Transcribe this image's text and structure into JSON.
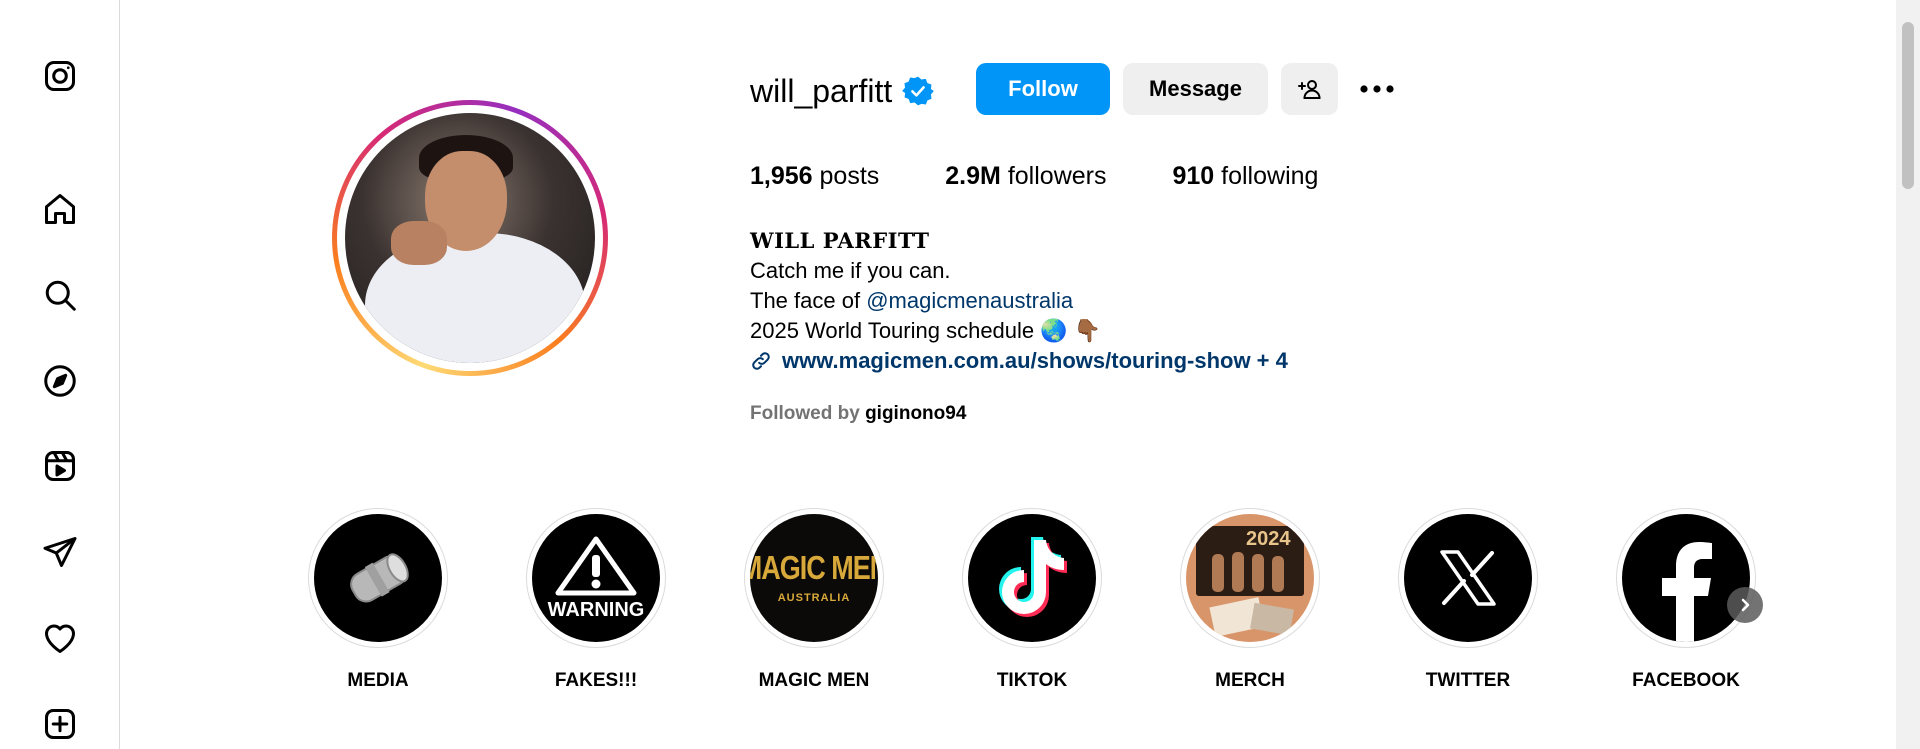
{
  "sidebar": {
    "items": [
      {
        "name": "instagram-logo-icon"
      },
      {
        "name": "home-icon"
      },
      {
        "name": "search-icon"
      },
      {
        "name": "explore-icon"
      },
      {
        "name": "reels-icon"
      },
      {
        "name": "messages-icon"
      },
      {
        "name": "notifications-icon"
      },
      {
        "name": "create-icon"
      }
    ]
  },
  "profile": {
    "username": "will_parfitt",
    "verified": true,
    "follow_label": "Follow",
    "message_label": "Message",
    "stats": {
      "posts_count": "1,956",
      "posts_label": "posts",
      "followers_count": "2.9M",
      "followers_label": "followers",
      "following_count": "910",
      "following_label": "following"
    },
    "bio": {
      "name": "WILL PARFITT",
      "line1": "Catch me if you can.",
      "line2_prefix": "The face of ",
      "line2_mention": "@magicmenaustralia",
      "line3": "2025 World Touring schedule 🌏 👇🏾",
      "link": "www.magicmen.com.au/shows/touring-show + 4"
    },
    "followed_by_prefix": "Followed by ",
    "followed_by_name": "giginono94"
  },
  "highlights": [
    {
      "label": "MEDIA"
    },
    {
      "label": "FAKES!!!",
      "image_text": "WARNING"
    },
    {
      "label": "MAGIC MEN",
      "image_text": "MAGIC MEN",
      "image_subtext": "AUSTRALIA"
    },
    {
      "label": "TIKTOK"
    },
    {
      "label": "MERCH",
      "image_text": "2024"
    },
    {
      "label": "TWITTER"
    },
    {
      "label": "FACEBOOK"
    }
  ],
  "colors": {
    "follow_button": "#0095f6",
    "secondary_button": "#efefef",
    "link": "#00376b",
    "verified": "#0095f6"
  }
}
